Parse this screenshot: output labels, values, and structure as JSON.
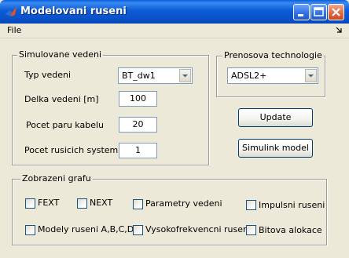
{
  "window": {
    "title": "Modelovani ruseni"
  },
  "menu": {
    "file_label": "File"
  },
  "simulated_line": {
    "group_title": "Simulovane vedeni",
    "line_type_label": "Typ vedeni",
    "line_type_value": "BT_dw1",
    "length_label": "Delka vedeni [m]",
    "length_value": "100",
    "pairs_label": "Pocet paru kabelu",
    "pairs_value": "20",
    "disturbers_label": "Pocet rusicich systemu",
    "disturbers_value": "1"
  },
  "technology": {
    "group_title": "Prenosova technologie",
    "value": "ADSL2+"
  },
  "actions": {
    "update_label": "Update",
    "simulink_label": "Simulink model"
  },
  "graphs": {
    "group_title": "Zobrazeni grafu",
    "fext_label": "FEXT",
    "next_label": "NEXT",
    "line_params_label": "Parametry vedeni",
    "impulse_label": "Impulsni ruseni",
    "models_label": "Modely ruseni A,B,C,D",
    "highfreq_label": "Vysokofrekvencni ruseni",
    "bitalloc_label": "Bitova alokace"
  }
}
